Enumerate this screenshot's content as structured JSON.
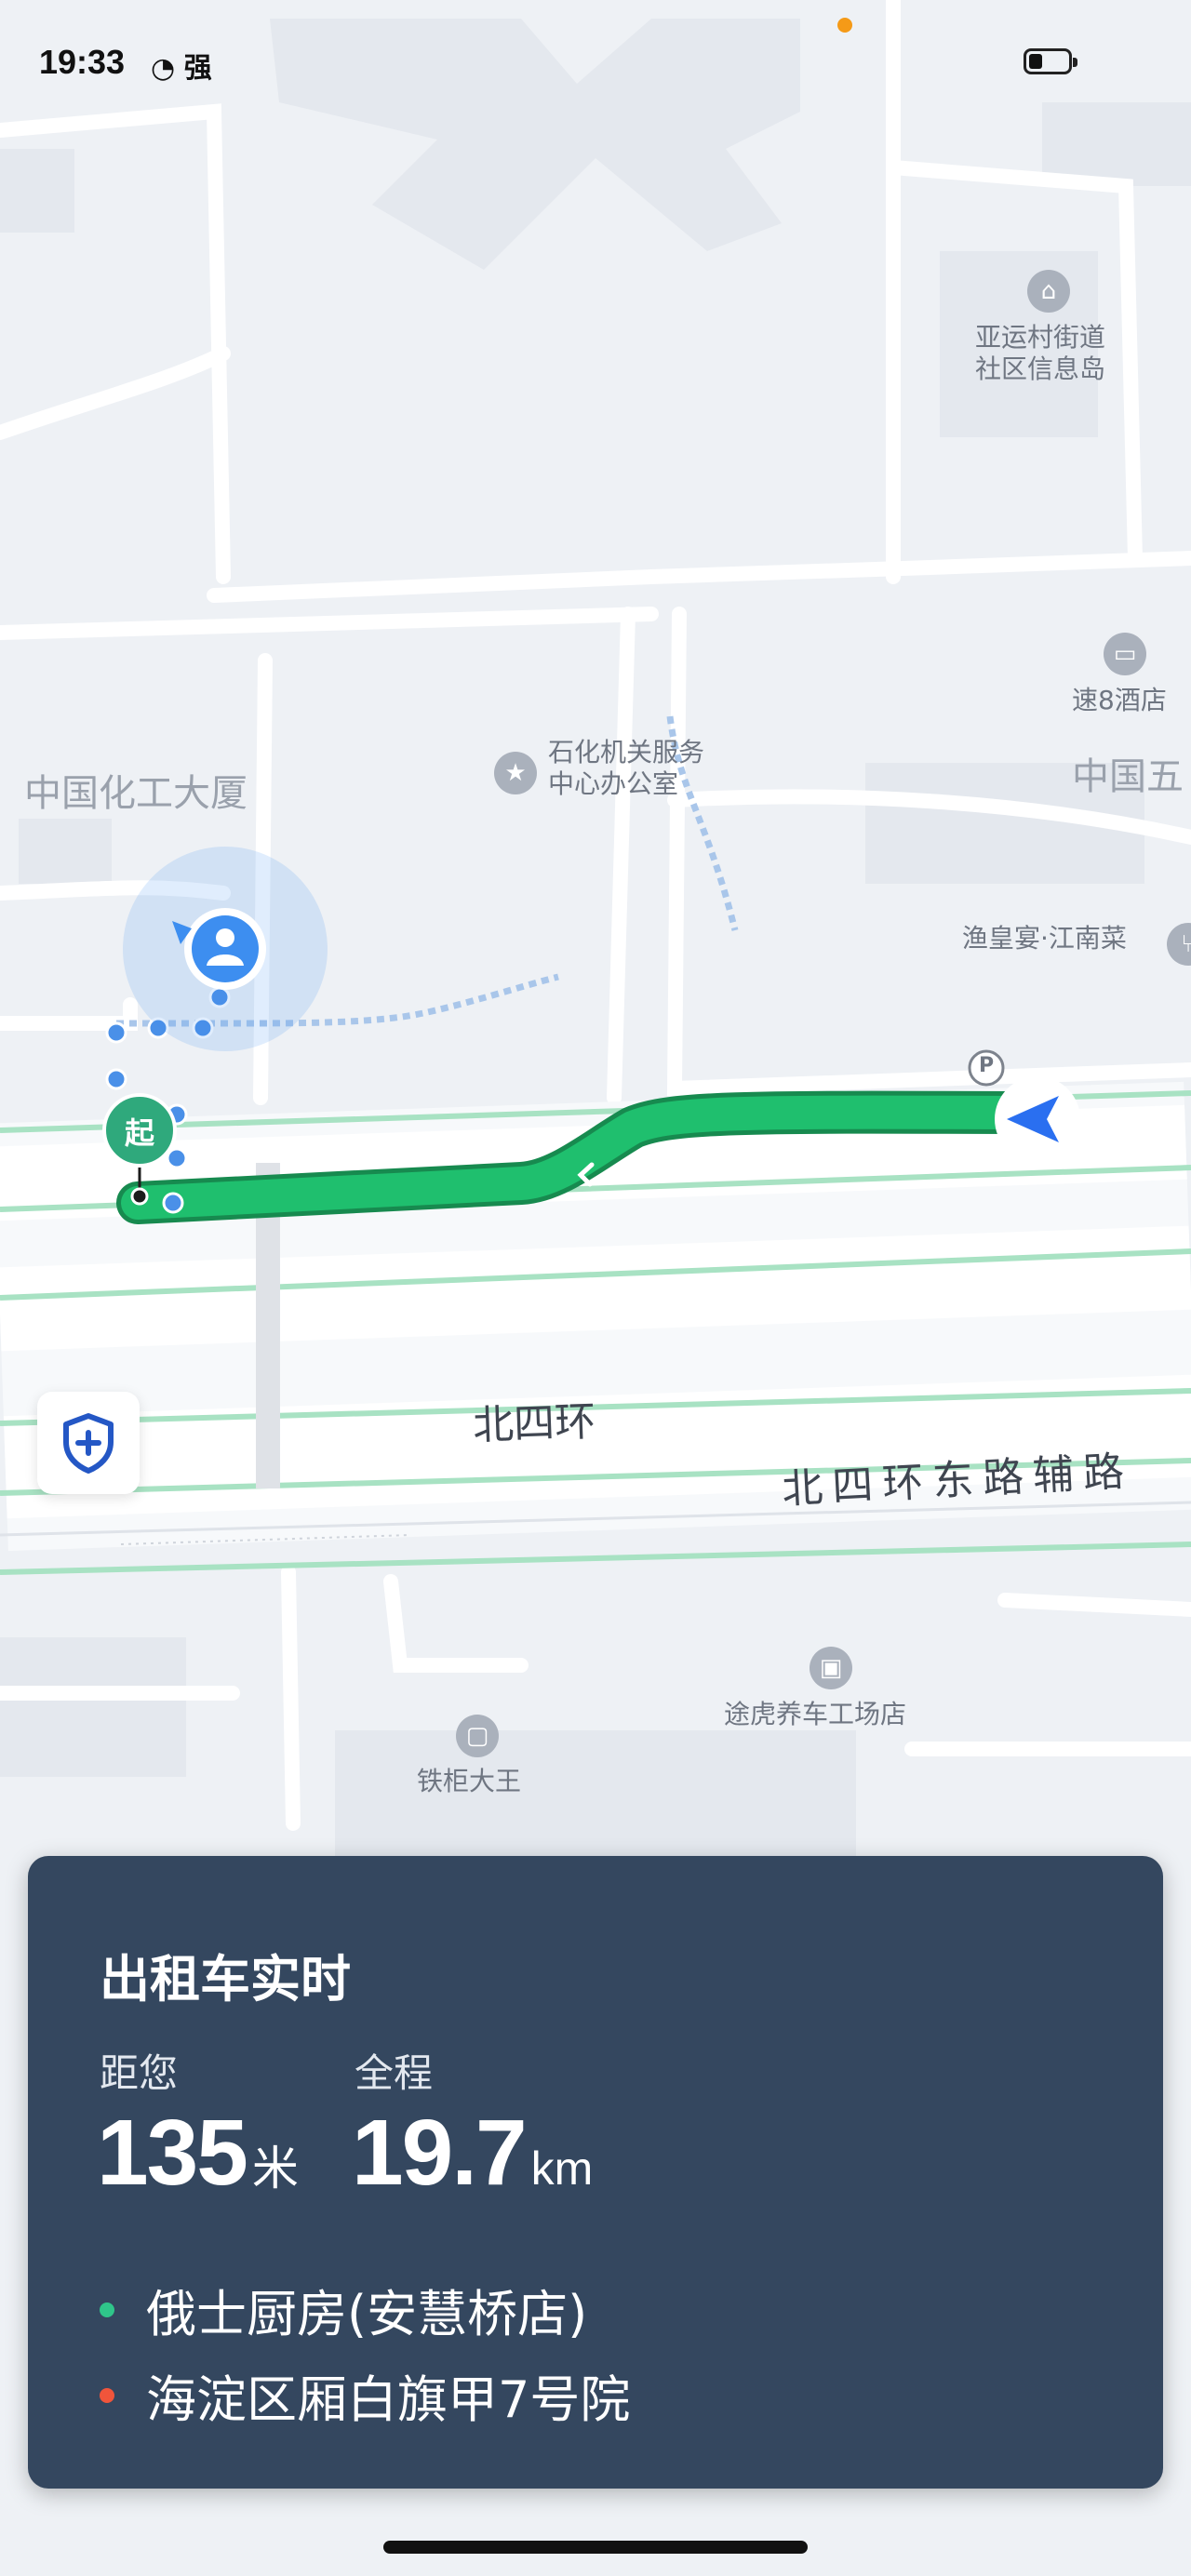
{
  "status_bar": {
    "time": "19:33",
    "signal_label": "强",
    "battery_level": 0.35
  },
  "map": {
    "pois": [
      {
        "name": "亚运村街道\n社区信息岛",
        "icon": "info-kiosk-icon"
      },
      {
        "name": "速8酒店",
        "icon": "hotel-bed-icon"
      },
      {
        "name": "中国五",
        "icon": ""
      },
      {
        "name": "石化机关服务\n中心办公室",
        "icon": "star-icon"
      },
      {
        "name": "中国化工大厦",
        "icon": ""
      },
      {
        "name": "渔皇宴·江南菜",
        "icon": "restaurant-icon"
      },
      {
        "name": "途虎养车工场店",
        "icon": "car-service-icon"
      },
      {
        "name": "铁柜大王",
        "icon": "lock-store-icon"
      }
    ],
    "roads": [
      {
        "name": "北四环"
      },
      {
        "name": "北四环东路辅路"
      }
    ],
    "start_marker": "起",
    "parking_marker": "P",
    "route_color": "#1fbf6e",
    "route_outline_color": "#178a4f",
    "user_location_color": "#3d8ef0",
    "vehicle_color": "#2a6ff0"
  },
  "safety_button": {
    "icon": "shield-plus-icon"
  },
  "info_card": {
    "title": "出租车实时",
    "distance": {
      "label": "距您",
      "value": "135",
      "unit": "米"
    },
    "total": {
      "label": "全程",
      "value": "19.7",
      "unit": "km"
    },
    "start_place": {
      "name": "俄士厨房(安慧桥店)",
      "dot_color": "#2fc58a"
    },
    "end_place": {
      "name": "海淀区厢白旗甲7号院",
      "dot_color": "#f0553b"
    }
  }
}
